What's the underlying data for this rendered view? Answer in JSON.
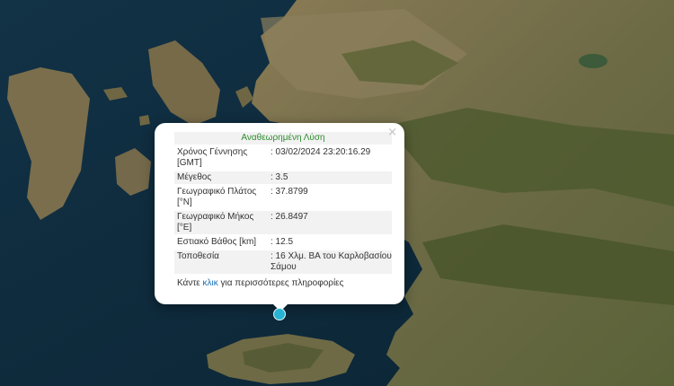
{
  "popup": {
    "heading": "Αναθεωρημένη Λύση",
    "close_symbol": "×",
    "rows": [
      {
        "label": "Χρόνος Γέννησης [GMT]",
        "value": ": 03/02/2024 23:20:16.29"
      },
      {
        "label": "Μέγεθος",
        "value": ": 3.5"
      },
      {
        "label": "Γεωγραφικό Πλάτος [°N]",
        "value": ": 37.8799"
      },
      {
        "label": "Γεωγραφικό Μήκος [°E]",
        "value": ": 26.8497"
      },
      {
        "label": "Εστιακό Βάθος [km]",
        "value": ": 12.5"
      },
      {
        "label": "Τοποθεσία",
        "value": ": 16 Χλμ. ΒΑ του Καρλοβασίου Σάμου"
      }
    ],
    "footer": {
      "prefix": "Κάντε ",
      "link": "κλικ",
      "suffix": " για περισσότερες πληροφορίες"
    }
  },
  "marker": {
    "icon": "earthquake-epicenter-icon",
    "color": "#27b3d3"
  },
  "colors": {
    "sea": "#0d2a3a",
    "land": "#6b6a44",
    "mountain": "#4e5a30",
    "heading_green": "#2e8b2e",
    "link_blue": "#1a6fb3"
  }
}
